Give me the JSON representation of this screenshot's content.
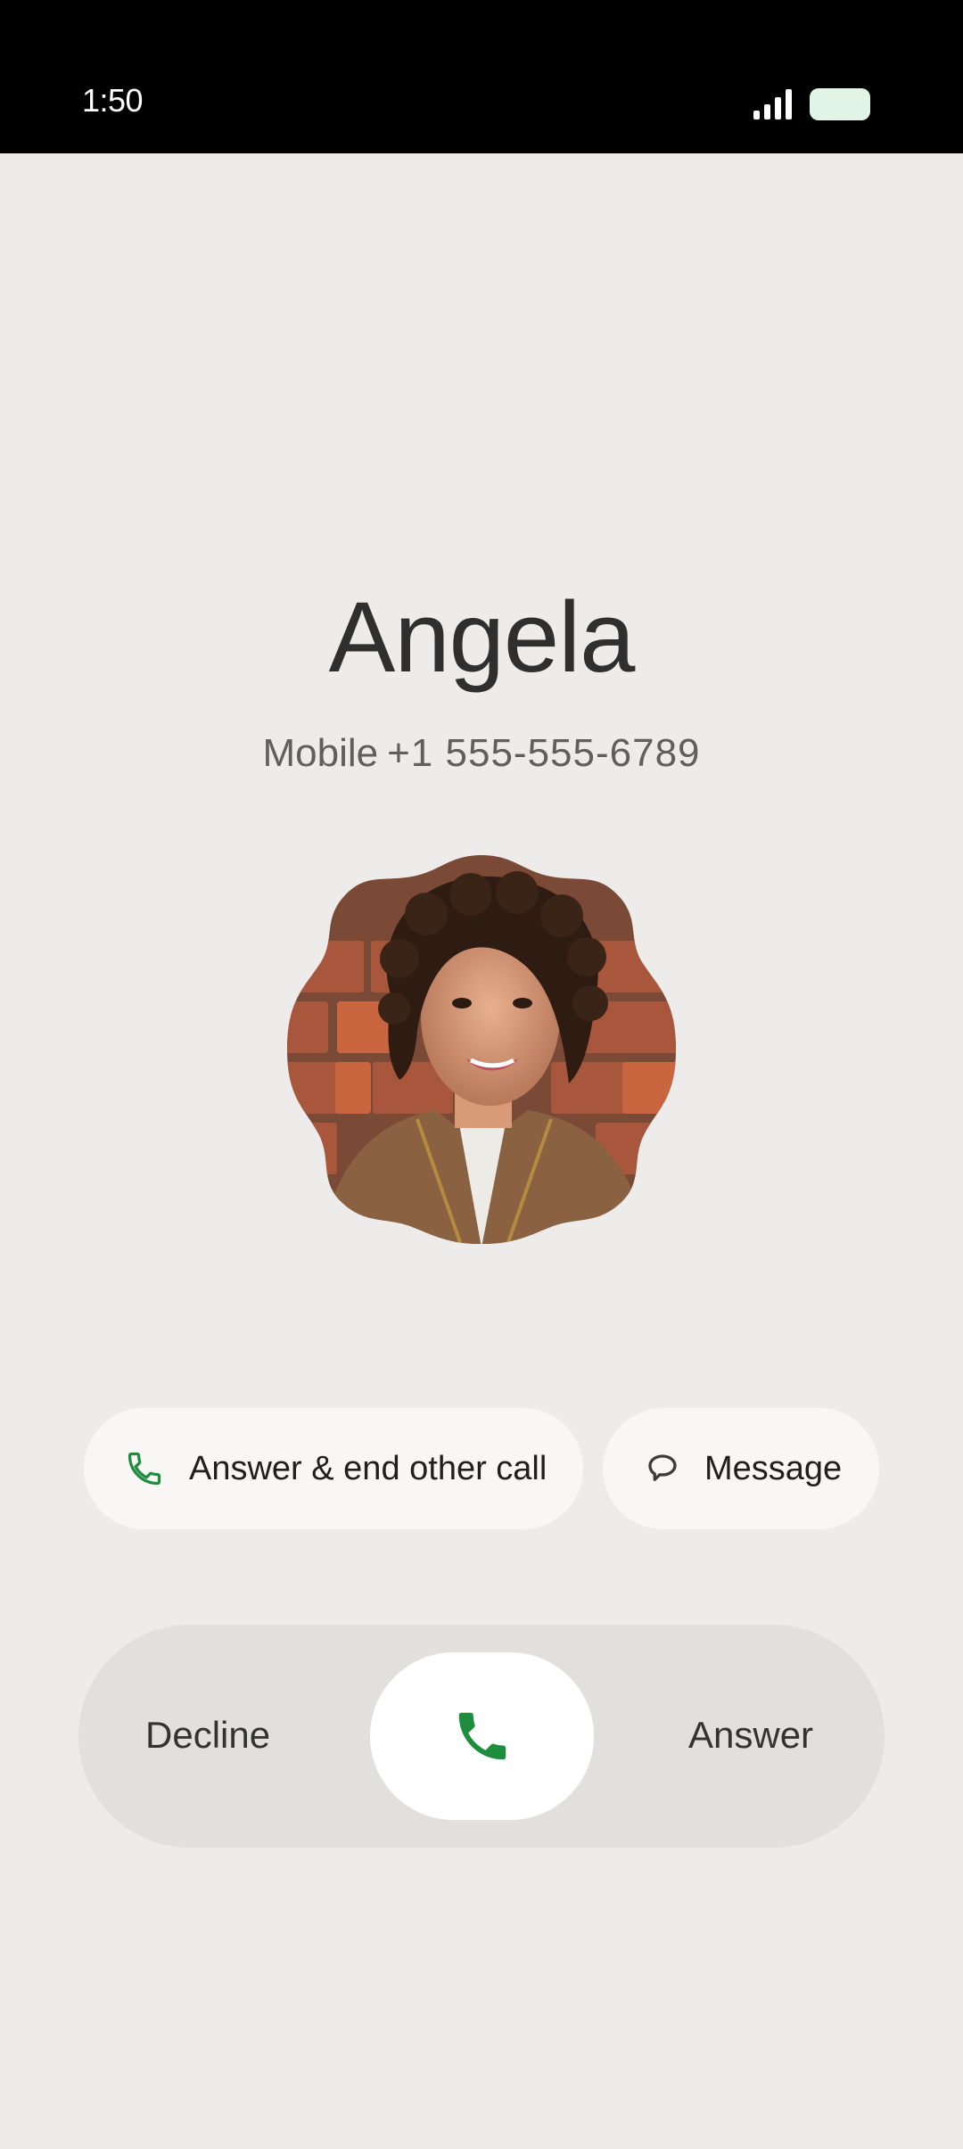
{
  "status_bar": {
    "time": "1:50",
    "signal_icon": "cellular-signal-icon",
    "battery_icon": "battery-icon"
  },
  "caller": {
    "name": "Angela",
    "label": "Mobile",
    "number": "+1 555-555-6789",
    "avatar": "contact-photo"
  },
  "actions": {
    "answer_end_label": "Answer & end other call",
    "answer_end_icon": "phone-icon",
    "message_label": "Message",
    "message_icon": "message-bubble-icon"
  },
  "slider": {
    "decline_label": "Decline",
    "answer_label": "Answer",
    "handle_icon": "phone-icon"
  },
  "colors": {
    "background": "#edecea",
    "accent_green": "#1e8e3e",
    "pill": "#f8f7f5",
    "track": "#e1e0de"
  }
}
